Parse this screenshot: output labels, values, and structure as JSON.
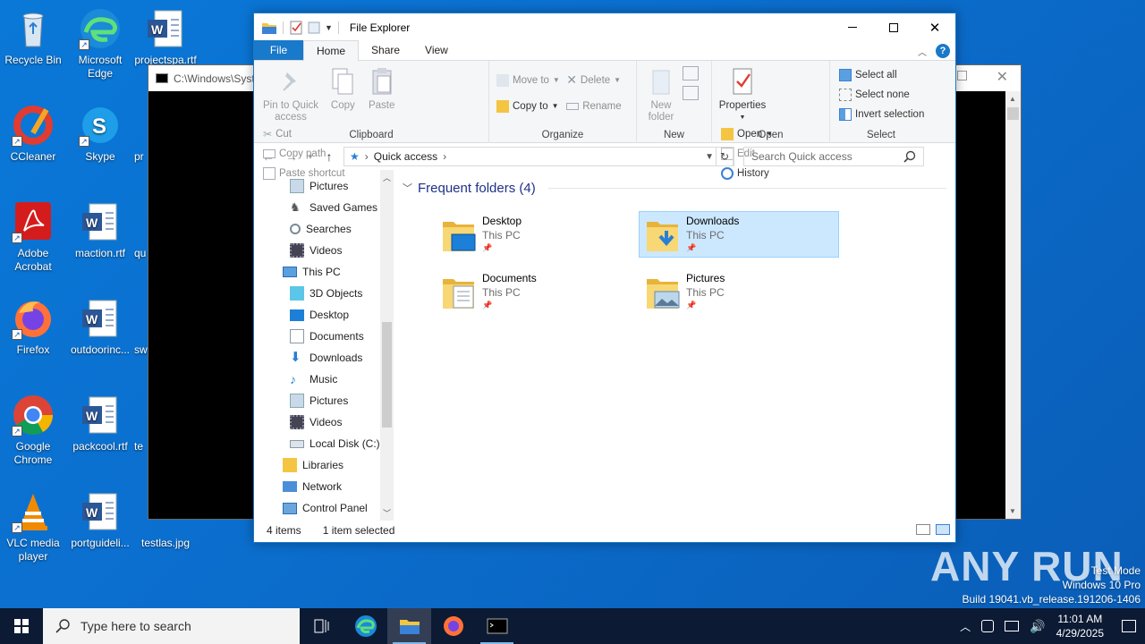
{
  "desktop": {
    "icons": [
      {
        "label": "Recycle Bin"
      },
      {
        "label": "Microsoft Edge"
      },
      {
        "label": "projectspa.rtf"
      },
      {
        "label": "CCleaner"
      },
      {
        "label": "Skype"
      },
      {
        "label": "pr"
      },
      {
        "label": "Adobe Acrobat"
      },
      {
        "label": "maction.rtf"
      },
      {
        "label": "qu"
      },
      {
        "label": "Firefox"
      },
      {
        "label": "outdoorinc..."
      },
      {
        "label": "sw"
      },
      {
        "label": "Google Chrome"
      },
      {
        "label": "packcool.rtf"
      },
      {
        "label": "te"
      },
      {
        "label": "VLC media player"
      },
      {
        "label": "portguideli..."
      },
      {
        "label": "testlas.jpg"
      }
    ]
  },
  "cmd_window": {
    "title": "C:\\Windows\\Syst"
  },
  "explorer": {
    "title": "File Explorer",
    "tabs": {
      "file": "File",
      "home": "Home",
      "share": "Share",
      "view": "View"
    },
    "ribbon": {
      "clipboard": {
        "group": "Clipboard",
        "pin": "Pin to Quick access",
        "copy": "Copy",
        "paste": "Paste",
        "cut": "Cut",
        "copy_path": "Copy path",
        "paste_shortcut": "Paste shortcut"
      },
      "organize": {
        "group": "Organize",
        "move_to": "Move to",
        "copy_to": "Copy to",
        "delete": "Delete",
        "rename": "Rename"
      },
      "new": {
        "group": "New",
        "new_folder": "New folder"
      },
      "open": {
        "group": "Open",
        "properties": "Properties",
        "open": "Open",
        "edit": "Edit",
        "history": "History"
      },
      "select": {
        "group": "Select",
        "select_all": "Select all",
        "select_none": "Select none",
        "invert": "Invert selection"
      }
    },
    "address": {
      "location": "Quick access",
      "search_placeholder": "Search Quick access"
    },
    "nav": [
      {
        "label": "Pictures"
      },
      {
        "label": "Saved Games"
      },
      {
        "label": "Searches"
      },
      {
        "label": "Videos"
      },
      {
        "label": "This PC"
      },
      {
        "label": "3D Objects"
      },
      {
        "label": "Desktop"
      },
      {
        "label": "Documents"
      },
      {
        "label": "Downloads"
      },
      {
        "label": "Music"
      },
      {
        "label": "Pictures"
      },
      {
        "label": "Videos"
      },
      {
        "label": "Local Disk (C:)"
      },
      {
        "label": "Libraries"
      },
      {
        "label": "Network"
      },
      {
        "label": "Control Panel"
      }
    ],
    "section_title": "Frequent folders (4)",
    "folders": [
      {
        "name": "Desktop",
        "location": "This PC"
      },
      {
        "name": "Downloads",
        "location": "This PC"
      },
      {
        "name": "Documents",
        "location": "This PC"
      },
      {
        "name": "Pictures",
        "location": "This PC"
      }
    ],
    "status": {
      "items": "4 items",
      "selected": "1 item selected"
    }
  },
  "taskbar": {
    "search_placeholder": "Type here to search",
    "time": "11:01 AM",
    "date": "4/29/2025"
  },
  "watermark": {
    "line1": "Test Mode",
    "line2": "Windows 10 Pro",
    "line3": "Build 19041.vb_release.191206-1406",
    "brand": "ANY RUN"
  },
  "colors": {
    "accent": "#1979ca",
    "selection": "#cce8ff",
    "taskbar": "#0c1a34",
    "desktop": "#0a78d7"
  }
}
